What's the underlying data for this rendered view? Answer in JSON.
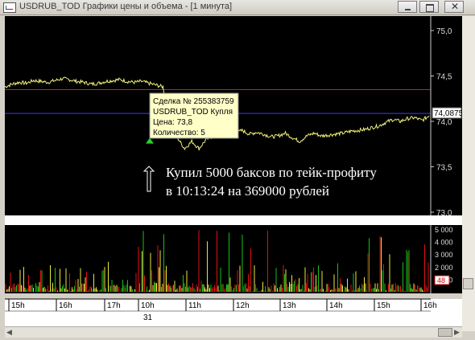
{
  "window": {
    "title": "USDRUB_TOD Графики цены и объема - [1 минута]",
    "minimize_icon": "minimize-icon",
    "maximize_icon": "maximize-icon",
    "close_icon": "close-icon"
  },
  "colors": {
    "background": "#000000",
    "price_line": "#f0f07a",
    "red_level": "#c81e1e",
    "blue_level": "#3c3cff",
    "volume_red": "#e01010",
    "volume_green": "#18c018",
    "volume_yellow": "#e8e840",
    "tooltip_bg": "#ffffc8"
  },
  "price_axis": {
    "ticks": [
      "75,0",
      "74,5",
      "74,0",
      "73,5",
      "73,0"
    ],
    "current_price": "74,0875"
  },
  "volume_axis": {
    "ticks": [
      "5 000",
      "4 000",
      "3 000",
      "2 000",
      "1 000"
    ],
    "current_volume": "48"
  },
  "time_axis": {
    "ticks": [
      "15h",
      "16h",
      "17h",
      "10h",
      "11h",
      "12h",
      "13h",
      "14h",
      "15h",
      "16h"
    ],
    "date_label": "31"
  },
  "trade_tooltip": {
    "line1": "Сделка № 255383759",
    "line2": "USDRUB_TOD Купля",
    "line3": "Цена: 73,8",
    "line4": "Количество: 5"
  },
  "annotation": {
    "line1": "Купил 5000 баксов по тейк-профиту",
    "line2": "в 10:13:24 на 369000 рублей"
  },
  "chart_data": {
    "type": "line",
    "y_range": [
      73.0,
      75.0
    ],
    "levels": {
      "red_line": 74.35,
      "blue_line": 74.0875
    },
    "price_series": [
      74.38,
      74.41,
      74.43,
      74.42,
      74.45,
      74.44,
      74.43,
      74.45,
      74.47,
      74.46,
      74.44,
      74.43,
      74.41,
      74.42,
      74.44,
      74.45,
      74.46,
      74.44,
      74.43,
      74.44,
      74.42,
      74.4,
      74.38,
      73.9,
      73.82,
      73.7,
      73.78,
      73.7,
      73.8,
      73.84,
      73.86,
      73.84,
      73.87,
      73.9,
      73.86,
      73.88,
      73.86,
      73.83,
      73.84,
      73.87,
      73.82,
      73.78,
      73.84,
      73.87,
      73.84,
      73.85,
      73.86,
      73.87,
      73.89,
      73.9,
      73.91,
      73.93,
      73.95,
      73.99,
      74.02,
      74.0,
      74.03,
      74.04,
      74.01,
      74.06
    ],
    "trade_marker": {
      "price": 73.8,
      "time": "10:13:24"
    },
    "volume_range": [
      0,
      5000
    ]
  }
}
